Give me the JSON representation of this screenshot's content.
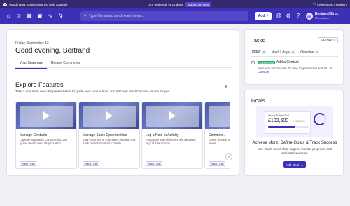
{
  "banner": {
    "watch_text": "Watch Now: Getting started with Capsule",
    "trial_text": "Your trial ends in 14 days",
    "subscribe_label": "Subscribe now",
    "invite_text": "Invite team members"
  },
  "nav": {
    "icons": [
      "home-icon",
      "person-icon",
      "calendar-icon",
      "briefcase-icon",
      "chart-icon",
      "bolt-icon"
    ],
    "search_placeholder": "Type / for search and recent items...",
    "search_kbd": "/",
    "add_label": "Add",
    "right_icons": [
      "at-icon",
      "gear-icon",
      "help-icon"
    ],
    "user_initials": "BB",
    "user_name": "Bertrand Bru...",
    "user_org": "Mindpalace"
  },
  "main": {
    "date": "Friday, September 12",
    "greeting": "Good evening, Bertrand",
    "tabs": [
      "Your Summary",
      "Recent Comments"
    ],
    "explore_title": "Explore Features",
    "explore_sub": "Take a minute to view the panels below to guide your next actions and discover what Capsule can do for you.",
    "features": [
      {
        "title": "Manage Contacts",
        "desc": "Capsule separates Contacts into two types, Person and Organization.",
        "button": "Watch Clip"
      },
      {
        "title": "Manage Sales Opportunities",
        "desc": "Stay in control of your sales pipeline and track deals from start to finish.",
        "button": "Watch Clip"
      },
      {
        "title": "Log a Note or Activity",
        "desc": "Keep your team informed with detailed logs of interactions.",
        "button": "Watch Clip"
      },
      {
        "title": "Commen...",
        "desc": "Leave threads of colleagues, p... app and email.",
        "button": "Watch Clip"
      }
    ]
  },
  "tasks": {
    "title": "Tasks",
    "add_label": "Add Task",
    "tabs": [
      {
        "label": "Today",
        "count": "0"
      },
      {
        "label": "Next 7 days",
        "count": "0"
      },
      {
        "label": "Overdue",
        "count": "1"
      }
    ],
    "item": {
      "tag": "Onboarding",
      "title": "Add a Contact",
      "desc": "Welcome to Capsule! It's time to get started and all... to",
      "link": "Capsule"
    }
  },
  "goals": {
    "title": "Goals",
    "illus_title": "Yearly Sales Goal",
    "illus_amount": "£102,600",
    "illus_target": "/ £150,000",
    "illus_progress": 0.68,
    "headline": "Achieve More: Define Goals & Track Success",
    "desc": "Use Goals to set clear targets, monitor progress, and celebrate success.",
    "add_label": "Add Goal"
  },
  "colors": {
    "brand": "#3d2fb8",
    "banner": "#33296e",
    "tag_green": "#19a86a"
  }
}
